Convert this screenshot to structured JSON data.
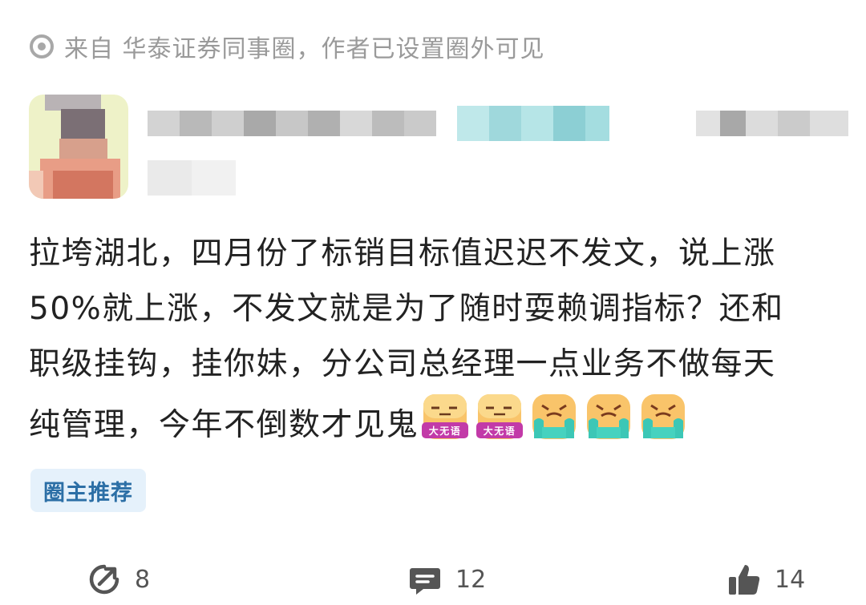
{
  "post": {
    "source_text": "来自 华泰证券同事圈，作者已设置圈外可见",
    "content_lines": [
      "拉垮湖北，四月份了标销目标值迟迟不发文，说上涨",
      "50%就上涨，不发文就是为了随时耍赖调指标？还和",
      "职级挂钩，挂你妹，分公司总经理一点业务不做每天",
      "纯管理，今年不倒数才见鬼"
    ],
    "emojis": [
      "speechless-emoji",
      "speechless-emoji",
      "crying-emoji",
      "crying-emoji",
      "crying-emoji"
    ],
    "emoji_caption": "大无语",
    "tag": "圈主推荐"
  },
  "actions": {
    "share_count": "8",
    "comment_count": "12",
    "like_count": "14"
  },
  "colors": {
    "text": "#222222",
    "muted": "#9a9a9a",
    "tag_bg": "#e5f1fb",
    "tag_text": "#2c6fa6"
  }
}
